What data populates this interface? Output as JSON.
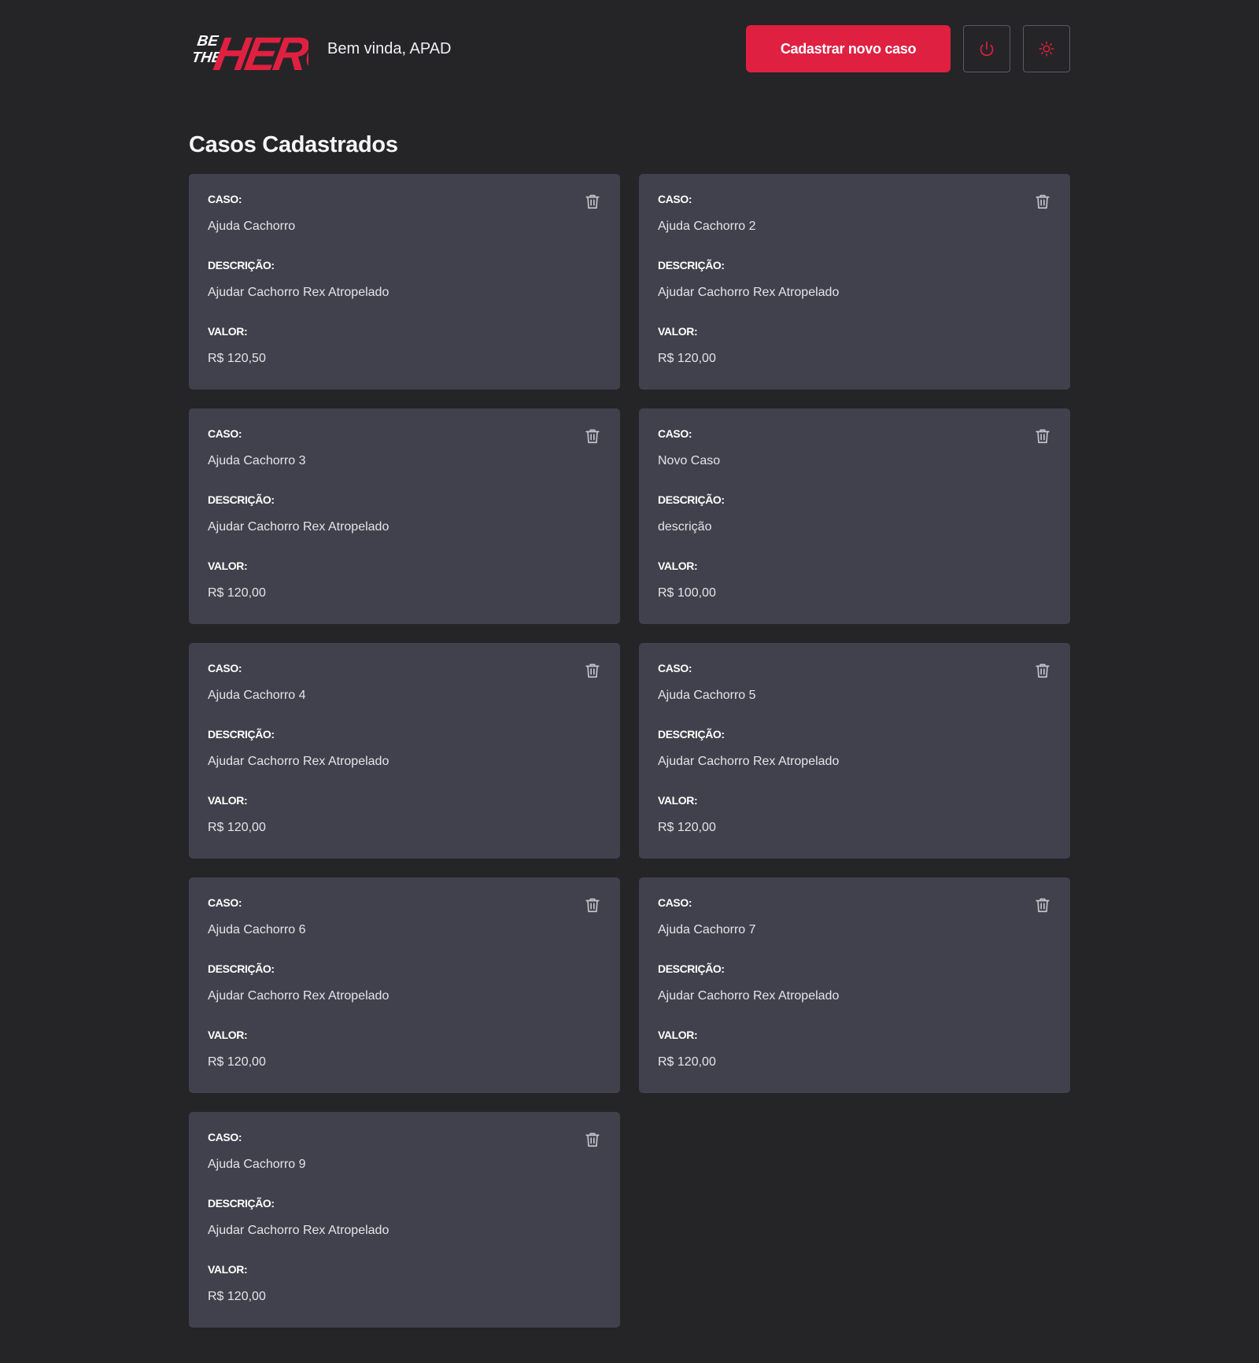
{
  "header": {
    "logo_text": "BE THE HERO",
    "welcome": "Bem vinda, APAD",
    "new_case_label": "Cadastrar novo caso",
    "logout_icon": "power-icon",
    "theme_icon": "sun-icon"
  },
  "colors": {
    "background": "#252527",
    "card": "#41414d",
    "accent": "#e02041"
  },
  "page": {
    "title": "Casos Cadastrados"
  },
  "labels": {
    "case": "CASO:",
    "description": "DESCRIÇÃO:",
    "value": "VALOR:"
  },
  "cases": [
    {
      "title": "Ajuda Cachorro",
      "description": "Ajudar Cachorro Rex Atropelado",
      "value": "R$ 120,50"
    },
    {
      "title": "Ajuda Cachorro 2",
      "description": "Ajudar Cachorro Rex Atropelado",
      "value": "R$ 120,00"
    },
    {
      "title": "Ajuda Cachorro 3",
      "description": "Ajudar Cachorro Rex Atropelado",
      "value": "R$ 120,00"
    },
    {
      "title": "Novo Caso",
      "description": "descrição",
      "value": "R$ 100,00"
    },
    {
      "title": "Ajuda Cachorro 4",
      "description": "Ajudar Cachorro Rex Atropelado",
      "value": "R$ 120,00"
    },
    {
      "title": "Ajuda Cachorro 5",
      "description": "Ajudar Cachorro Rex Atropelado",
      "value": "R$ 120,00"
    },
    {
      "title": "Ajuda Cachorro 6",
      "description": "Ajudar Cachorro Rex Atropelado",
      "value": "R$ 120,00"
    },
    {
      "title": "Ajuda Cachorro 7",
      "description": "Ajudar Cachorro Rex Atropelado",
      "value": "R$ 120,00"
    },
    {
      "title": "Ajuda Cachorro 9",
      "description": "Ajudar Cachorro Rex Atropelado",
      "value": "R$ 120,00"
    }
  ]
}
